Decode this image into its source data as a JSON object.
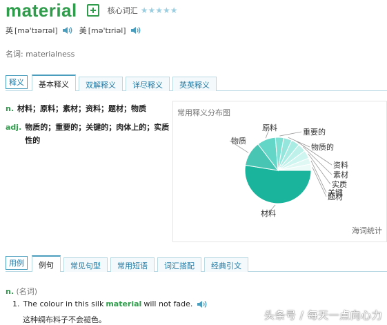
{
  "header": {
    "word": "material",
    "level_label": "核心词汇",
    "stars": "★★★★★"
  },
  "pronunciation": {
    "uk_label": "英",
    "uk_phonetic": "[mə'tɪərɪəl]",
    "us_label": "美",
    "us_phonetic": "[mə'tɪriəl]"
  },
  "forms": {
    "label": "名词:",
    "value": "materialness"
  },
  "tabs1": {
    "tag": "释义",
    "items": [
      "基本释义",
      "双解释义",
      "详尽释义",
      "英英释义"
    ]
  },
  "definitions": [
    {
      "pos": "n.",
      "text": "材料；原料；素材；资料；题材；物质"
    },
    {
      "pos": "adj.",
      "text": "物质的；重要的；关键的；肉体上的；实质性的"
    }
  ],
  "chart": {
    "title": "常用释义分布图",
    "footer": "海词统计"
  },
  "chart_data": {
    "type": "pie",
    "title": "常用释义分布图",
    "categories": [
      "材料",
      "物质",
      "原料",
      "重要的",
      "物质的",
      "资料",
      "素材",
      "实质",
      "关键",
      "题材"
    ],
    "values": [
      52,
      12,
      9,
      4,
      4,
      4,
      4,
      4,
      3,
      3
    ],
    "colors": [
      "#1ab39b",
      "#48c6b3",
      "#63d6c8",
      "#7edfd3",
      "#94e6dc",
      "#a9ece4",
      "#bdf1ea",
      "#cff5f0",
      "#dff8f4",
      "#ebfbf8"
    ],
    "display_labels": [
      "材料",
      "物质",
      "原料",
      "重要的",
      "物质的",
      "资料",
      "素材",
      "实质",
      "关键",
      "题材"
    ]
  },
  "tabs2": {
    "tag": "用例",
    "items": [
      "例句",
      "常见句型",
      "常用短语",
      "词汇搭配",
      "经典引文"
    ]
  },
  "example": {
    "pos": "n.",
    "pos_paren": "(名词)",
    "num": "1.",
    "before": "The colour in this silk",
    "highlight": "material",
    "after": "will not fade.",
    "translation": "这种绸布料子不会褪色。"
  },
  "watermark": "头条号 / 每天一点向心力"
}
